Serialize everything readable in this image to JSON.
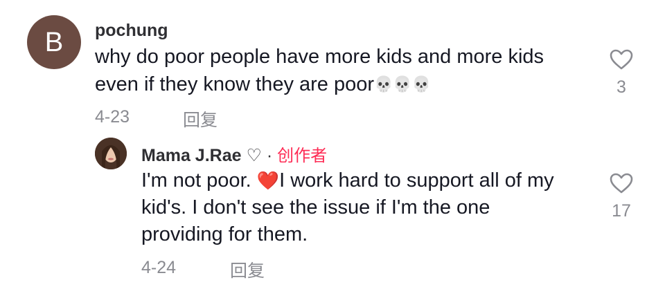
{
  "comments": [
    {
      "avatar_letter": "B",
      "username": "pochung",
      "text_line1": "why do poor people have more kids and more kids",
      "text_line2": "even if they know they are poor",
      "emoji": [
        "💀",
        "💀",
        "💀"
      ],
      "date": "4-23",
      "reply_label": "回复",
      "like_count": "3"
    }
  ],
  "reply": {
    "username": "Mama J.Rae ♡",
    "separator": "·",
    "creator_label": "创作者",
    "text_line1_a": "I'm not poor. ",
    "heart_emoji": "❤️",
    "text_line1_b": "I work hard to support all of my",
    "text_line2": "kid's. I don't see the issue if I'm the one",
    "text_line3": "providing for them.",
    "date": "4-24",
    "reply_label": "回复",
    "like_count": "17"
  }
}
